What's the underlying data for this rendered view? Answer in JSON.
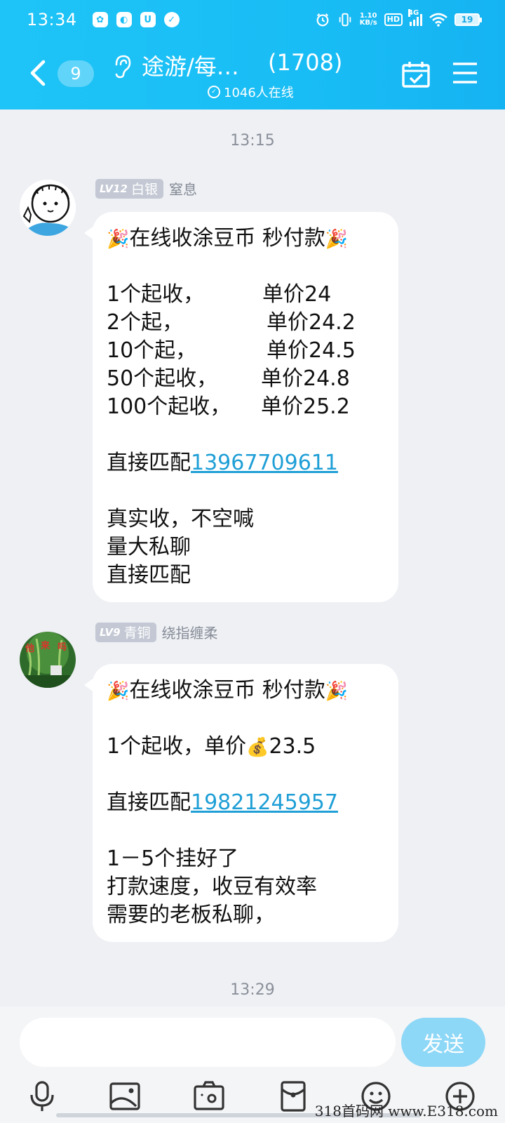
{
  "status_bar": {
    "time": "13:34",
    "net_speed_value": "1.10",
    "net_speed_unit": "KB/s",
    "hd": "HD",
    "network": "4G",
    "battery": "19"
  },
  "header": {
    "unread_count": "9",
    "group_name": "途游/每…",
    "member_count": "(1708)",
    "online_text": "1046人在线"
  },
  "chat": {
    "time_1": "13:15",
    "time_2": "13:29",
    "messages": [
      {
        "level": "LV12",
        "rank": "白银",
        "sender": "窒息",
        "title": "在线收涂豆币 秒付款",
        "prices": [
          {
            "qty": "1个起收，",
            "price": "单价24"
          },
          {
            "qty": "2个起，",
            "price": "单价24.2"
          },
          {
            "qty": "10个起，",
            "price": "单价24.5"
          },
          {
            "qty": "50个起收，",
            "price": "单价24.8"
          },
          {
            "qty": "100个起收，",
            "price": "单价25.2"
          }
        ],
        "match_prefix": "直接匹配",
        "phone": "13967709611",
        "line_a": "真实收，不空喊",
        "line_b": "量大私聊",
        "line_c": "直接匹配"
      },
      {
        "level": "LV9",
        "rank": "青铜",
        "sender": "绕指缠柔",
        "title": "在线收涂豆币 秒付款",
        "price_prefix": "1个起收，单价",
        "price_emoji": "💰",
        "price_value": "23.5",
        "match_prefix": "直接匹配",
        "phone": "19821245957",
        "line_a": "1－5个挂好了",
        "line_b": "打款速度，收豆有效率",
        "line_c": "需要的老板私聊，"
      }
    ]
  },
  "input": {
    "send_label": "发送"
  },
  "watermark": "318首码网 www.E318.com",
  "colors": {
    "header_blue": "#19bdf5",
    "link_blue": "#1f9fd6",
    "send_button": "#8dd7f7"
  }
}
